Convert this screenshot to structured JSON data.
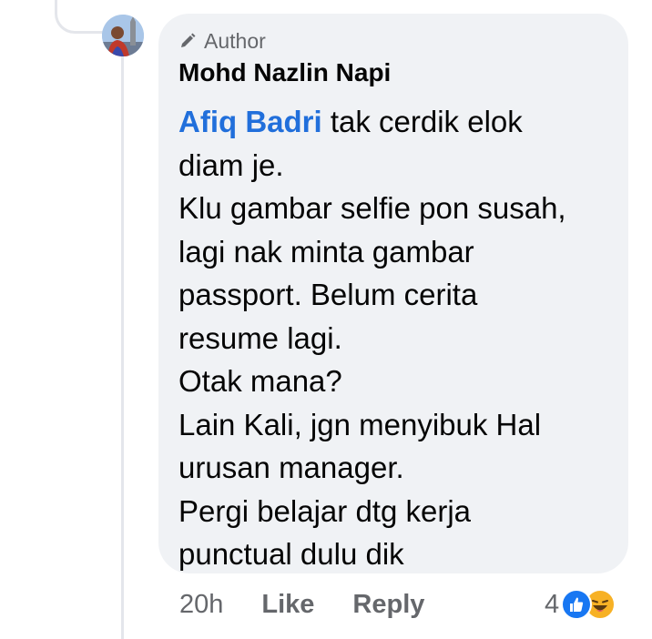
{
  "comment": {
    "author_badge": "Author",
    "name": "Mohd Nazlin Napi",
    "mention": "Afiq Badri",
    "first_line_rest": " tak cerdik elok",
    "lines": [
      "diam je.",
      "Klu gambar selfie pon susah,",
      "lagi nak minta gambar",
      "passport.  Belum cerita",
      "resume lagi.",
      "Otak mana?",
      "Lain Kali, jgn menyibuk Hal",
      "urusan manager.",
      "Pergi belajar dtg kerja",
      "punctual dulu dik"
    ]
  },
  "meta": {
    "time": "20h",
    "like_label": "Like",
    "reply_label": "Reply",
    "reaction_count": "4",
    "reaction_icons": [
      "like-icon",
      "haha-icon"
    ]
  },
  "colors": {
    "bubble": "#f0f2f5",
    "mention": "#216fdb",
    "meta_text": "#65676b",
    "like_blue": "#1877f2",
    "haha_yellow": "#f7b125"
  }
}
